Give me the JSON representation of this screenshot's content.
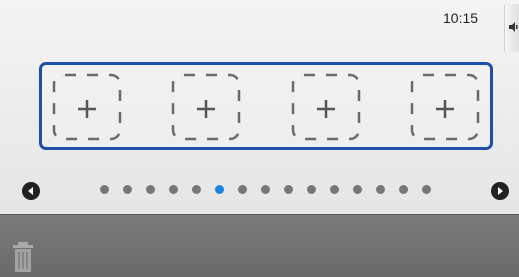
{
  "status_bar": {
    "time": "10:15"
  },
  "side_panel": {
    "icon": "speaker-icon"
  },
  "widget_panel": {
    "slots": [
      {
        "icon": "plus-icon",
        "label": "+"
      },
      {
        "icon": "plus-icon",
        "label": "+"
      },
      {
        "icon": "plus-icon",
        "label": "+"
      },
      {
        "icon": "plus-icon",
        "label": "+"
      }
    ]
  },
  "pager": {
    "prev_icon": "arrow-left-icon",
    "next_icon": "arrow-right-icon",
    "page_count": 15,
    "active_index": 5
  },
  "bottom_bar": {
    "trash_icon": "trash-icon"
  },
  "colors": {
    "accent": "#1f4faa",
    "active_dot": "#1a86e0",
    "inactive_dot": "#777777"
  }
}
